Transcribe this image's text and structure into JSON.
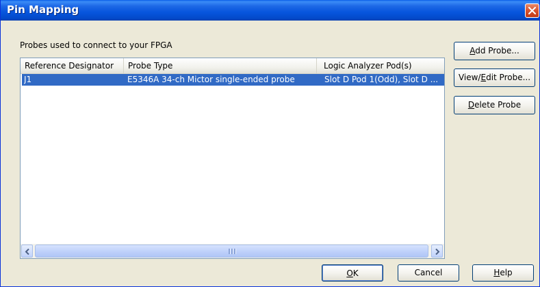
{
  "window": {
    "title": "Pin Mapping",
    "close_icon": "close-icon",
    "accent_color": "#0a5fe8",
    "selection_color": "#316ac5"
  },
  "group_label": "Probes used to connect to your FPGA",
  "table": {
    "columns": [
      "Reference Designator",
      "Probe Type",
      "Logic Analyzer Pod(s)"
    ],
    "rows": [
      [
        "J1",
        "E5346A 34-ch Mictor single-ended probe",
        "Slot D Pod 1(Odd), Slot D ..."
      ]
    ],
    "selected_row": 0
  },
  "side_buttons": {
    "add_probe": {
      "prefix": "",
      "mnemonic": "A",
      "suffix": "dd Probe..."
    },
    "view_edit_probe": {
      "prefix": "View/",
      "mnemonic": "E",
      "suffix": "dit Probe..."
    },
    "delete_probe": {
      "prefix": "",
      "mnemonic": "D",
      "suffix": "elete Probe"
    }
  },
  "bottom_buttons": {
    "ok": {
      "prefix": "",
      "mnemonic": "O",
      "suffix": "K"
    },
    "cancel": {
      "label": "Cancel"
    },
    "help": {
      "prefix": "",
      "mnemonic": "H",
      "suffix": "elp"
    }
  }
}
